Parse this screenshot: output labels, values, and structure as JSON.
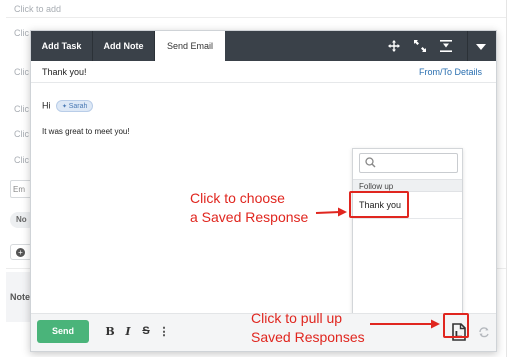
{
  "background": {
    "rows": [
      "Click to add",
      "Clic",
      "Clic",
      "Clic",
      "Clic",
      "Clic"
    ],
    "chip_text": "Em",
    "pill_text": "No",
    "notes_label": "Note"
  },
  "toolbar": {
    "tabs": [
      {
        "label": "Add Task"
      },
      {
        "label": "Add Note"
      },
      {
        "label": "Send Email"
      }
    ],
    "icons": [
      "move-icon",
      "expand-icon",
      "minimize-icon",
      "chevron-down-icon"
    ]
  },
  "email": {
    "subject": "Thank you!",
    "from_to_link": "From/To Details",
    "greeting": "Hi",
    "recipient_chip": "Sarah",
    "body": "It was great to meet you!"
  },
  "saved_responses": {
    "search_placeholder": "",
    "group_header": "Follow up",
    "items": [
      {
        "label": "Thank you"
      }
    ]
  },
  "bottom_bar": {
    "send_label": "Send",
    "format_buttons": {
      "bold": "B",
      "italic": "I",
      "strike": "S",
      "more": "⋮"
    }
  },
  "annotations": {
    "choose_line1": "Click to choose",
    "choose_line2": "a Saved Response",
    "pull_line1": "Click to pull up",
    "pull_line2": "Saved Responses",
    "color": "#e0261f"
  },
  "colors": {
    "toolbar_bg": "#3a4149",
    "send_button": "#4ab47a",
    "link": "#2a6fb0",
    "annotation": "#e0261f"
  }
}
